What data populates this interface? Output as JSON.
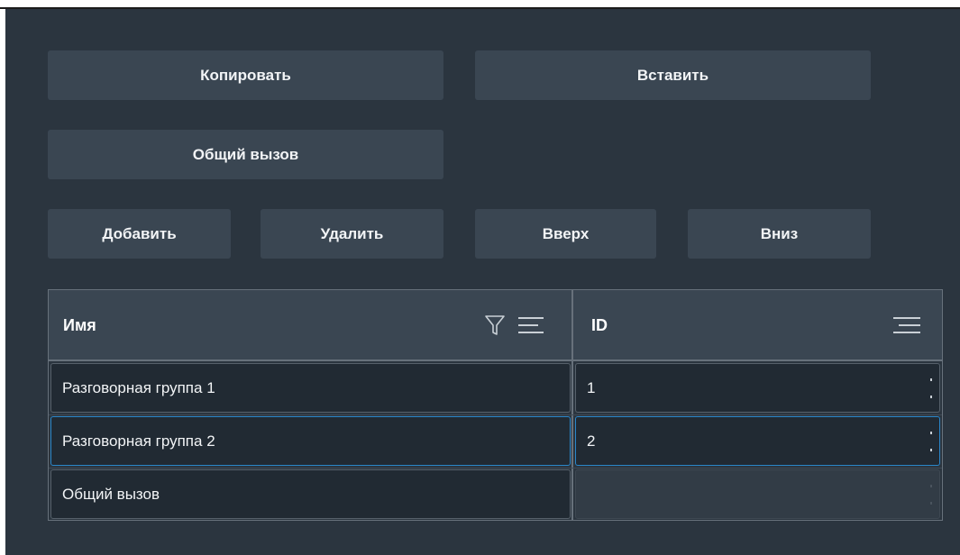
{
  "toolbar": {
    "copy_label": "Копировать",
    "paste_label": "Вставить",
    "general_call_label": "Общий вызов",
    "add_label": "Добавить",
    "delete_label": "Удалить",
    "up_label": "Вверх",
    "down_label": "Вниз"
  },
  "table": {
    "columns": [
      {
        "label": "Имя",
        "icons": [
          "filter-icon",
          "sort-lines-icon"
        ]
      },
      {
        "label": "ID",
        "icons": [
          "sort-lines-icon"
        ]
      }
    ],
    "rows": [
      {
        "name": "Разговорная группа 1",
        "id": "1",
        "selected": false
      },
      {
        "name": "Разговорная группа 2",
        "id": "2",
        "selected": true
      },
      {
        "name": "Общий вызов",
        "id": "",
        "selected": false
      }
    ]
  },
  "colors": {
    "panel_background": "#2b353f",
    "button_background": "#3a4652",
    "cell_background": "#212a33",
    "selection_accent": "#2a86c9",
    "text": "#f2f4f6"
  }
}
